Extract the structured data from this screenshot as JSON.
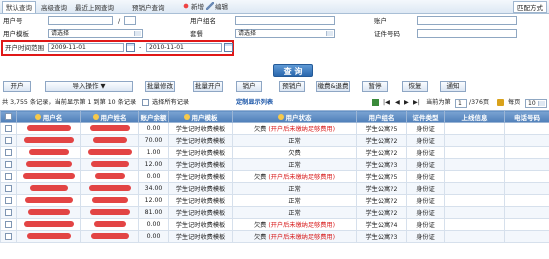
{
  "tabs": [
    "默认查询",
    "高级查询",
    "最近上网查询",
    "预销户查询"
  ],
  "toolbar": {
    "add": "新增",
    "edit": "编辑",
    "layout": "匹配方式"
  },
  "form": {
    "user_id_label": "用户号",
    "user_name_label": "用户组名",
    "account_label": "账户",
    "template_label": "用户模板",
    "template_value": "请选择",
    "package_label": "套餐",
    "package_value": "请选择",
    "cert_no_label": "证件号码",
    "open_time_label": "开户时间范围",
    "date_from": "2009-11-01",
    "date_to": "2010-11-01",
    "range_sep": "-"
  },
  "search_button": "查 询",
  "actions": [
    "开户",
    "导入操作",
    "批量修改",
    "批量开户",
    "销户",
    "预销户",
    "缴费&退费",
    "暂停",
    "恢复",
    "通知"
  ],
  "info": {
    "summary": "共 3,755 条记录，当前显示第 1 到第 10 条记录",
    "select_all": "选择所有记录",
    "custom_cols": "定制显示列表",
    "page_label": "当前为第",
    "page_value": "1",
    "page_total": "/376页",
    "per_page_label": "每页",
    "per_page_value": "10"
  },
  "table": {
    "headers": [
      "",
      "用户名",
      "用户姓名",
      "账户余额",
      "用户模板",
      "用户状态",
      "用户组名",
      "证件类型",
      "上线信息",
      "电话号码"
    ],
    "rows": [
      {
        "balance": "0.00",
        "template": "学生记时收费模板",
        "status": "欠费",
        "note": "(开户后未缴纳足够费用)",
        "group": "学生公寓?5",
        "cert": "身份证"
      },
      {
        "balance": "70.00",
        "template": "学生记时收费模板",
        "status": "正常",
        "note": "",
        "group": "学生公寓?2",
        "cert": "身份证"
      },
      {
        "balance": "1.00",
        "template": "学生记时收费模板",
        "status": "欠费",
        "note": "",
        "group": "学生公寓?2",
        "cert": "身份证"
      },
      {
        "balance": "12.00",
        "template": "学生记时收费模板",
        "status": "正常",
        "note": "",
        "group": "学生公寓?3",
        "cert": "身份证"
      },
      {
        "balance": "0.00",
        "template": "学生记时收费模板",
        "status": "欠费",
        "note": "(开户后未缴纳足够费用)",
        "group": "学生公寓?5",
        "cert": "身份证"
      },
      {
        "balance": "34.00",
        "template": "学生记时收费模板",
        "status": "正常",
        "note": "",
        "group": "学生公寓?2",
        "cert": "身份证"
      },
      {
        "balance": "12.00",
        "template": "学生记时收费模板",
        "status": "正常",
        "note": "",
        "group": "学生公寓?2",
        "cert": "身份证"
      },
      {
        "balance": "81.00",
        "template": "学生记时收费模板",
        "status": "正常",
        "note": "",
        "group": "学生公寓?2",
        "cert": "身份证"
      },
      {
        "balance": "0.00",
        "template": "学生记时收费模板",
        "status": "欠费",
        "note": "(开户后未缴纳足够费用)",
        "group": "学生公寓?4",
        "cert": "身份证"
      },
      {
        "balance": "0.00",
        "template": "学生记时收费模板",
        "status": "欠费",
        "note": "(开户后未缴纳足够费用)",
        "group": "学生公寓?3",
        "cert": "身份证"
      }
    ]
  },
  "colors": {
    "header_blue": "#4f7fb9",
    "highlight_red": "#e01818",
    "accent": "#1b56a8"
  }
}
